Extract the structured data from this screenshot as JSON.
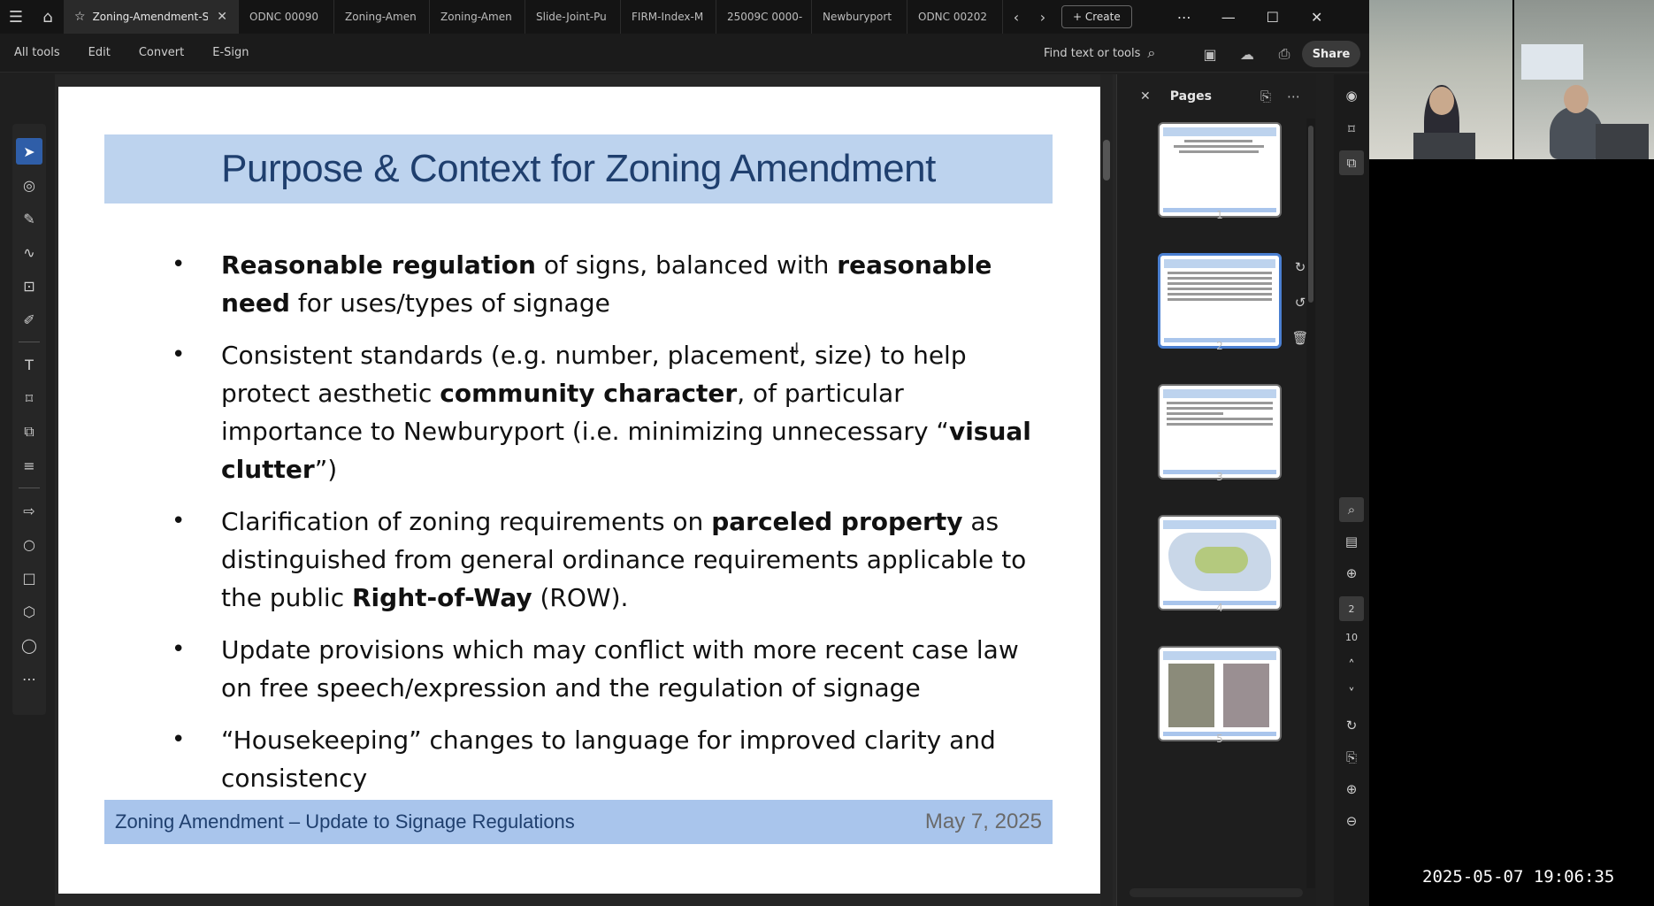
{
  "tabbar": {
    "tabs": [
      {
        "label": "Zoning-Amendment-Sli",
        "active": true
      },
      {
        "label": "ODNC 00090"
      },
      {
        "label": "Zoning-Amen"
      },
      {
        "label": "Zoning-Amen"
      },
      {
        "label": "Slide-Joint-Pu"
      },
      {
        "label": "FIRM-Index-M"
      },
      {
        "label": "25009C 0000-"
      },
      {
        "label": "Newburyport"
      },
      {
        "label": "ODNC 00202"
      }
    ],
    "create_label": "+ Create"
  },
  "menubar": {
    "items": [
      "All tools",
      "Edit",
      "Convert",
      "E-Sign"
    ],
    "find_label": "Find text or tools",
    "share_label": "Share"
  },
  "slide": {
    "title": "Purpose & Context for Zoning Amendment",
    "bullets": [
      {
        "parts": [
          {
            "t": "Reasonable regulation",
            "b": true
          },
          {
            "t": " of signs, balanced with "
          },
          {
            "t": "reasonable need",
            "b": true
          },
          {
            "t": " for uses/types of signage"
          }
        ]
      },
      {
        "parts": [
          {
            "t": "Consistent standards (e.g. number, placement, size) to help protect aesthetic  "
          },
          {
            "t": "community character",
            "b": true
          },
          {
            "t": ", of particular importance to Newburyport (i.e. minimizing unnecessary “"
          },
          {
            "t": "visual clutter",
            "b": true
          },
          {
            "t": "”)"
          }
        ]
      },
      {
        "parts": [
          {
            "t": "Clarification of zoning requirements on "
          },
          {
            "t": "parceled property",
            "b": true
          },
          {
            "t": " as distinguished from general ordinance requirements applicable to the public "
          },
          {
            "t": "Right-of-Way",
            "b": true
          },
          {
            "t": " (ROW)."
          }
        ]
      },
      {
        "parts": [
          {
            "t": "Update provisions which may conflict with more recent case law on free speech/expression and the regulation of signage"
          }
        ]
      },
      {
        "parts": [
          {
            "t": "“Housekeeping” changes to language for improved clarity and consistency"
          }
        ]
      }
    ],
    "footer_left": "Zoning Amendment – Update to Signage Regulations",
    "footer_right": "May 7, 2025"
  },
  "pages_panel": {
    "title": "Pages",
    "page_numbers": [
      "1",
      "2",
      "3",
      "4",
      "5"
    ],
    "selected_page": 2,
    "page_indicator": "2",
    "page_total": "10"
  },
  "video": {
    "timestamp": "2025-05-07  19:06:35"
  },
  "colors": {
    "title_bar": "#bdd3ee",
    "title_text": "#1f3f6e",
    "footer_bar": "#a9c5ec",
    "accent": "#2f5ea8"
  }
}
